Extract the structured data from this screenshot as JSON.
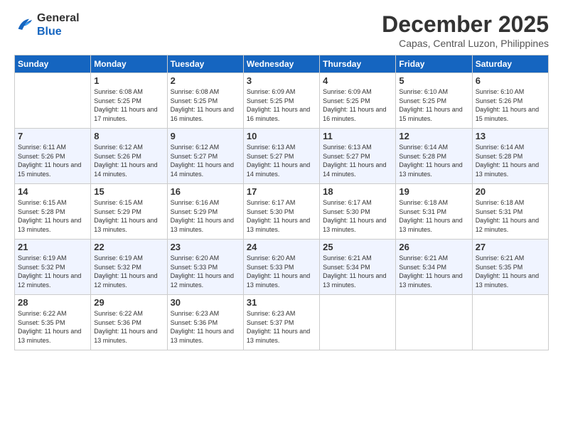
{
  "logo": {
    "line1": "General",
    "line2": "Blue"
  },
  "title": "December 2025",
  "location": "Capas, Central Luzon, Philippines",
  "weekdays": [
    "Sunday",
    "Monday",
    "Tuesday",
    "Wednesday",
    "Thursday",
    "Friday",
    "Saturday"
  ],
  "weeks": [
    [
      {
        "day": "",
        "sunrise": "",
        "sunset": "",
        "daylight": ""
      },
      {
        "day": "1",
        "sunrise": "Sunrise: 6:08 AM",
        "sunset": "Sunset: 5:25 PM",
        "daylight": "Daylight: 11 hours and 17 minutes."
      },
      {
        "day": "2",
        "sunrise": "Sunrise: 6:08 AM",
        "sunset": "Sunset: 5:25 PM",
        "daylight": "Daylight: 11 hours and 16 minutes."
      },
      {
        "day": "3",
        "sunrise": "Sunrise: 6:09 AM",
        "sunset": "Sunset: 5:25 PM",
        "daylight": "Daylight: 11 hours and 16 minutes."
      },
      {
        "day": "4",
        "sunrise": "Sunrise: 6:09 AM",
        "sunset": "Sunset: 5:25 PM",
        "daylight": "Daylight: 11 hours and 16 minutes."
      },
      {
        "day": "5",
        "sunrise": "Sunrise: 6:10 AM",
        "sunset": "Sunset: 5:25 PM",
        "daylight": "Daylight: 11 hours and 15 minutes."
      },
      {
        "day": "6",
        "sunrise": "Sunrise: 6:10 AM",
        "sunset": "Sunset: 5:26 PM",
        "daylight": "Daylight: 11 hours and 15 minutes."
      }
    ],
    [
      {
        "day": "7",
        "sunrise": "Sunrise: 6:11 AM",
        "sunset": "Sunset: 5:26 PM",
        "daylight": "Daylight: 11 hours and 15 minutes."
      },
      {
        "day": "8",
        "sunrise": "Sunrise: 6:12 AM",
        "sunset": "Sunset: 5:26 PM",
        "daylight": "Daylight: 11 hours and 14 minutes."
      },
      {
        "day": "9",
        "sunrise": "Sunrise: 6:12 AM",
        "sunset": "Sunset: 5:27 PM",
        "daylight": "Daylight: 11 hours and 14 minutes."
      },
      {
        "day": "10",
        "sunrise": "Sunrise: 6:13 AM",
        "sunset": "Sunset: 5:27 PM",
        "daylight": "Daylight: 11 hours and 14 minutes."
      },
      {
        "day": "11",
        "sunrise": "Sunrise: 6:13 AM",
        "sunset": "Sunset: 5:27 PM",
        "daylight": "Daylight: 11 hours and 14 minutes."
      },
      {
        "day": "12",
        "sunrise": "Sunrise: 6:14 AM",
        "sunset": "Sunset: 5:28 PM",
        "daylight": "Daylight: 11 hours and 13 minutes."
      },
      {
        "day": "13",
        "sunrise": "Sunrise: 6:14 AM",
        "sunset": "Sunset: 5:28 PM",
        "daylight": "Daylight: 11 hours and 13 minutes."
      }
    ],
    [
      {
        "day": "14",
        "sunrise": "Sunrise: 6:15 AM",
        "sunset": "Sunset: 5:28 PM",
        "daylight": "Daylight: 11 hours and 13 minutes."
      },
      {
        "day": "15",
        "sunrise": "Sunrise: 6:15 AM",
        "sunset": "Sunset: 5:29 PM",
        "daylight": "Daylight: 11 hours and 13 minutes."
      },
      {
        "day": "16",
        "sunrise": "Sunrise: 6:16 AM",
        "sunset": "Sunset: 5:29 PM",
        "daylight": "Daylight: 11 hours and 13 minutes."
      },
      {
        "day": "17",
        "sunrise": "Sunrise: 6:17 AM",
        "sunset": "Sunset: 5:30 PM",
        "daylight": "Daylight: 11 hours and 13 minutes."
      },
      {
        "day": "18",
        "sunrise": "Sunrise: 6:17 AM",
        "sunset": "Sunset: 5:30 PM",
        "daylight": "Daylight: 11 hours and 13 minutes."
      },
      {
        "day": "19",
        "sunrise": "Sunrise: 6:18 AM",
        "sunset": "Sunset: 5:31 PM",
        "daylight": "Daylight: 11 hours and 13 minutes."
      },
      {
        "day": "20",
        "sunrise": "Sunrise: 6:18 AM",
        "sunset": "Sunset: 5:31 PM",
        "daylight": "Daylight: 11 hours and 12 minutes."
      }
    ],
    [
      {
        "day": "21",
        "sunrise": "Sunrise: 6:19 AM",
        "sunset": "Sunset: 5:32 PM",
        "daylight": "Daylight: 11 hours and 12 minutes."
      },
      {
        "day": "22",
        "sunrise": "Sunrise: 6:19 AM",
        "sunset": "Sunset: 5:32 PM",
        "daylight": "Daylight: 11 hours and 12 minutes."
      },
      {
        "day": "23",
        "sunrise": "Sunrise: 6:20 AM",
        "sunset": "Sunset: 5:33 PM",
        "daylight": "Daylight: 11 hours and 12 minutes."
      },
      {
        "day": "24",
        "sunrise": "Sunrise: 6:20 AM",
        "sunset": "Sunset: 5:33 PM",
        "daylight": "Daylight: 11 hours and 13 minutes."
      },
      {
        "day": "25",
        "sunrise": "Sunrise: 6:21 AM",
        "sunset": "Sunset: 5:34 PM",
        "daylight": "Daylight: 11 hours and 13 minutes."
      },
      {
        "day": "26",
        "sunrise": "Sunrise: 6:21 AM",
        "sunset": "Sunset: 5:34 PM",
        "daylight": "Daylight: 11 hours and 13 minutes."
      },
      {
        "day": "27",
        "sunrise": "Sunrise: 6:21 AM",
        "sunset": "Sunset: 5:35 PM",
        "daylight": "Daylight: 11 hours and 13 minutes."
      }
    ],
    [
      {
        "day": "28",
        "sunrise": "Sunrise: 6:22 AM",
        "sunset": "Sunset: 5:35 PM",
        "daylight": "Daylight: 11 hours and 13 minutes."
      },
      {
        "day": "29",
        "sunrise": "Sunrise: 6:22 AM",
        "sunset": "Sunset: 5:36 PM",
        "daylight": "Daylight: 11 hours and 13 minutes."
      },
      {
        "day": "30",
        "sunrise": "Sunrise: 6:23 AM",
        "sunset": "Sunset: 5:36 PM",
        "daylight": "Daylight: 11 hours and 13 minutes."
      },
      {
        "day": "31",
        "sunrise": "Sunrise: 6:23 AM",
        "sunset": "Sunset: 5:37 PM",
        "daylight": "Daylight: 11 hours and 13 minutes."
      },
      {
        "day": "",
        "sunrise": "",
        "sunset": "",
        "daylight": ""
      },
      {
        "day": "",
        "sunrise": "",
        "sunset": "",
        "daylight": ""
      },
      {
        "day": "",
        "sunrise": "",
        "sunset": "",
        "daylight": ""
      }
    ]
  ]
}
